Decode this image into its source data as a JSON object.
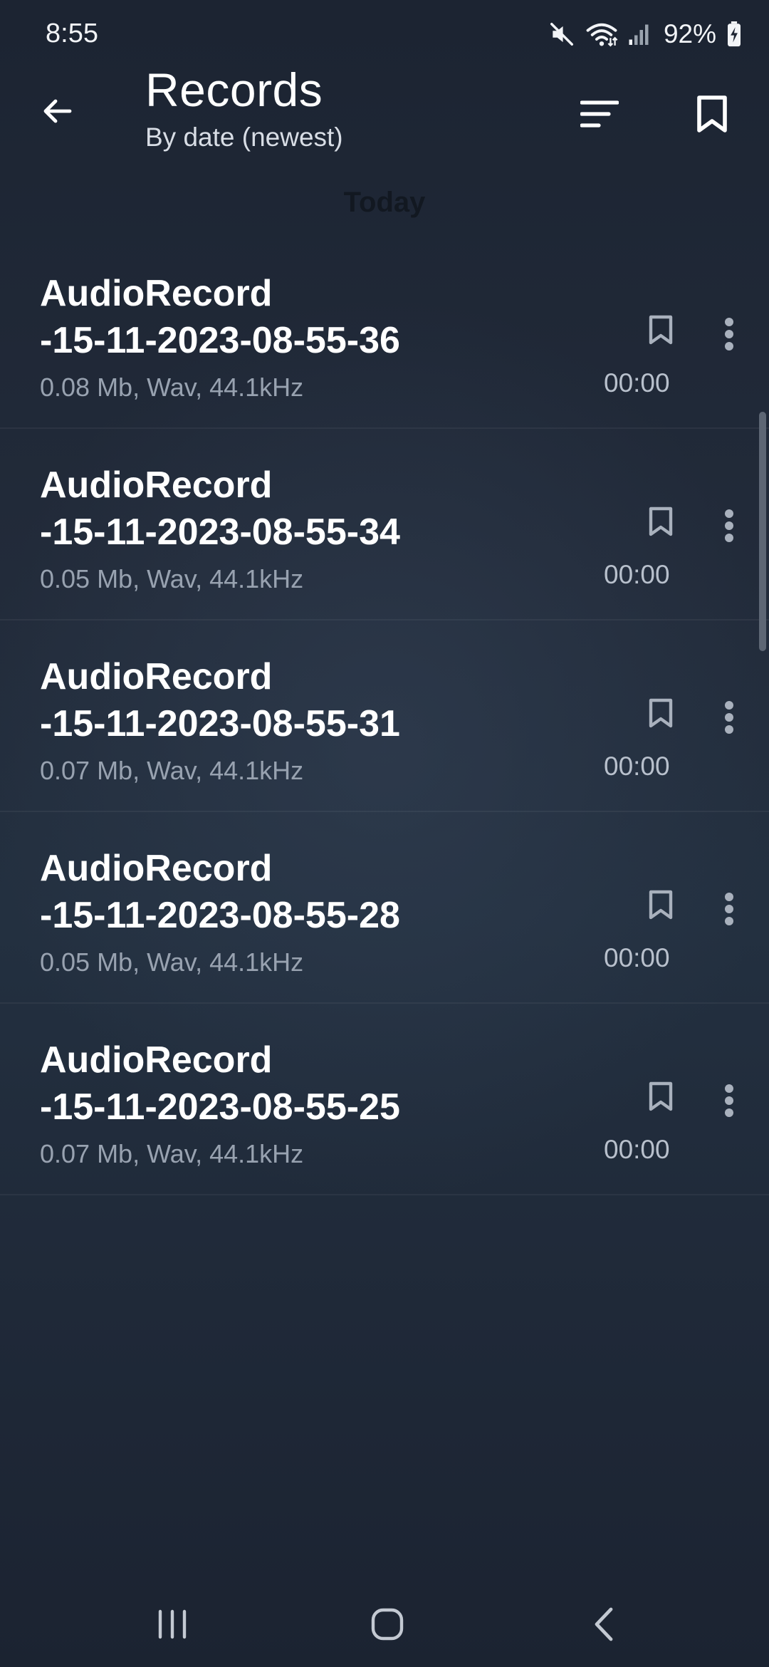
{
  "status_bar": {
    "time": "8:55",
    "battery": "92%",
    "icons": [
      "mute-icon",
      "wifi-icon",
      "signal-icon",
      "battery-charging-icon"
    ]
  },
  "app_bar": {
    "title": "Records",
    "subtitle": "By date (newest)",
    "icons": [
      "back-arrow-icon",
      "sort-icon",
      "bookmark-icon"
    ]
  },
  "section": {
    "header": "Today"
  },
  "records": [
    {
      "name_line1": "AudioRecord",
      "name_line2": "-15-11-2023-08-55-36",
      "meta": "0.08 Mb, Wav, 44.1kHz",
      "duration": "00:00"
    },
    {
      "name_line1": "AudioRecord",
      "name_line2": "-15-11-2023-08-55-34",
      "meta": "0.05 Mb, Wav, 44.1kHz",
      "duration": "00:00"
    },
    {
      "name_line1": "AudioRecord",
      "name_line2": "-15-11-2023-08-55-31",
      "meta": "0.07 Mb, Wav, 44.1kHz",
      "duration": "00:00"
    },
    {
      "name_line1": "AudioRecord",
      "name_line2": "-15-11-2023-08-55-28",
      "meta": "0.05 Mb, Wav, 44.1kHz",
      "duration": "00:00"
    },
    {
      "name_line1": "AudioRecord",
      "name_line2": "-15-11-2023-08-55-25",
      "meta": "0.07 Mb, Wav, 44.1kHz",
      "duration": "00:00"
    }
  ],
  "colors": {
    "background": "#212a39",
    "primary_text": "#ffffff",
    "secondary_text": "#98a2b0",
    "icon": "#a9b1bd"
  }
}
